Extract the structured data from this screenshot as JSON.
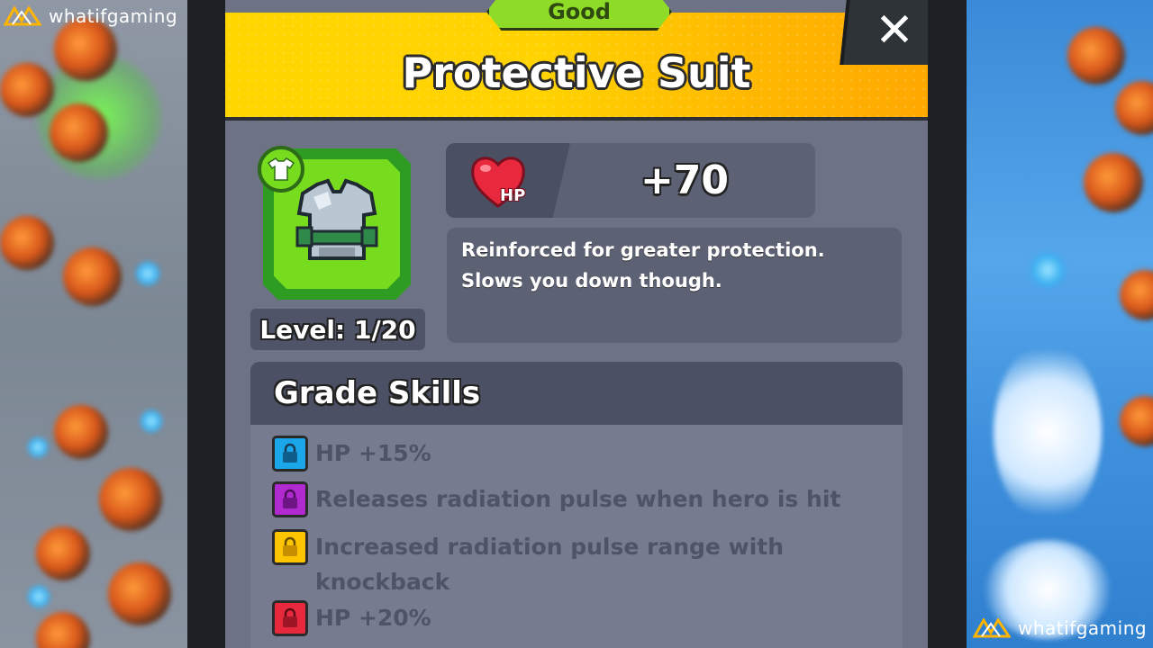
{
  "watermark": {
    "brand": "whatifgaming"
  },
  "item": {
    "grade": "Good",
    "name": "Protective Suit",
    "level_text": "Level: 1/20",
    "stat_icon_label": "HP",
    "stat_value": "+70",
    "description_lines": [
      "Reinforced for greater protection.",
      "Slows you down though."
    ]
  },
  "skills": {
    "title": "Grade Skills",
    "items": [
      {
        "text": "HP +15%",
        "lock_color": "#1aa6e8"
      },
      {
        "text": "Releases radiation pulse when hero is hit",
        "lock_color": "#b02ad0"
      },
      {
        "text": "Increased radiation pulse range with knockback",
        "lock_color": "#ffc400"
      },
      {
        "text": "HP +20%",
        "lock_color": "#e8283c"
      }
    ]
  },
  "colors": {
    "header_yellow": "#ffd200",
    "grade_green": "#8fdc28",
    "panel_gray": "#6d7285"
  },
  "icons": {
    "close": "close-icon",
    "heart": "heart-icon",
    "shirt": "shirt-icon",
    "armor": "armor-vest-icon",
    "lock": "lock-icon"
  }
}
